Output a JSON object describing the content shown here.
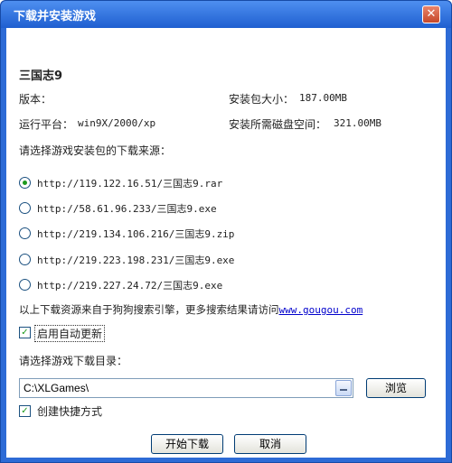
{
  "window": {
    "title": "下载并安装游戏",
    "close_glyph": "✕"
  },
  "game": {
    "name": "三国志9",
    "version_label": "版本：",
    "version_value": "",
    "size_label": "安装包大小：",
    "size_value": "187.00MB",
    "platform_label": "运行平台：",
    "platform_value": "win9X/2000/xp",
    "disk_label": "安装所需磁盘空间：",
    "disk_value": "321.00MB"
  },
  "sources": {
    "prompt": "请选择游戏安装包的下载来源：",
    "selected_index": 0,
    "items": [
      {
        "url": "http://119.122.16.51/三国志9.rar"
      },
      {
        "url": "http://58.61.96.233/三国志9.exe"
      },
      {
        "url": "http://219.134.106.216/三国志9.zip"
      },
      {
        "url": "http://219.223.198.231/三国志9.exe"
      },
      {
        "url": "http://219.227.24.72/三国志9.exe"
      }
    ]
  },
  "notice": {
    "text": "以上下载资源来自于狗狗搜索引擎，更多搜索结果请访问",
    "link": "www.gougou.com"
  },
  "auto_update": {
    "label": "启用自动更新",
    "checked": true
  },
  "directory": {
    "prompt": "请选择游戏下载目录：",
    "value": "C:\\XLGames\\",
    "browse_label": "浏览"
  },
  "shortcut": {
    "label": "创建快捷方式",
    "checked": true
  },
  "footer": {
    "start_label": "开始下载",
    "cancel_label": "取消"
  },
  "colors": {
    "title_bar": "#2d6bd6",
    "link": "#0000cc",
    "check_mark": "#1d9a1d"
  }
}
